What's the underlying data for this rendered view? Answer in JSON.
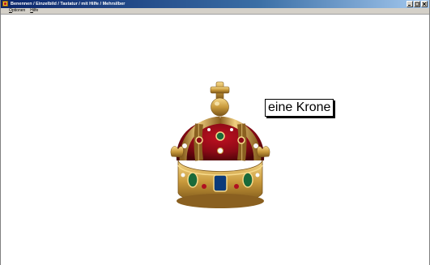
{
  "window": {
    "title": "Benennen / Einzelbild / Tastatur / mit Hilfe / Mehrsilber",
    "icon": "app-icon",
    "buttons": [
      "minimize-icon",
      "maximize-icon",
      "close-icon"
    ]
  },
  "menu": {
    "items": [
      {
        "label": "Optionen",
        "mnemonic": "O"
      },
      {
        "label": "Hilfe",
        "mnemonic": "H"
      }
    ]
  },
  "picture": {
    "icon": "crown-image"
  },
  "answer": {
    "text": "eine Krone"
  }
}
